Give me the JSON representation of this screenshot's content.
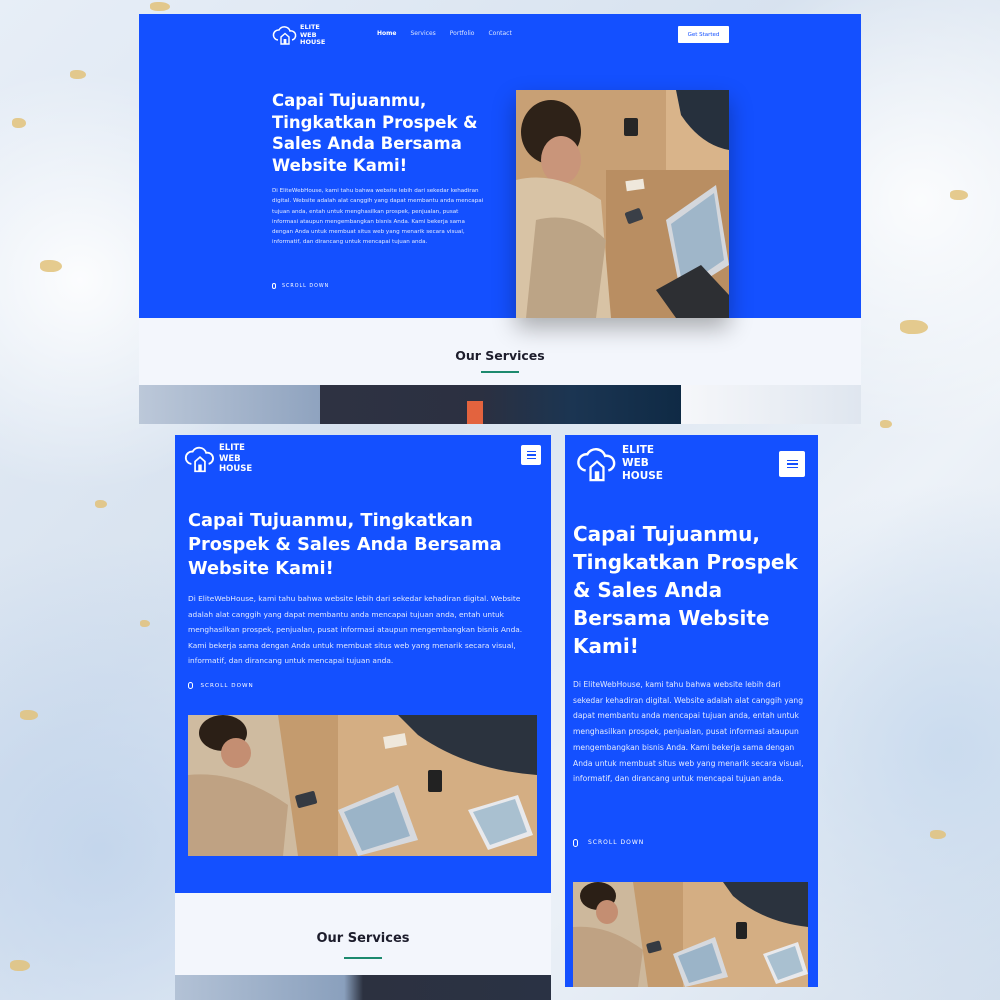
{
  "brand": {
    "line1": "ELITE",
    "line2": "WEB",
    "line3": "HOUSE"
  },
  "nav": {
    "home": "Home",
    "services": "Services",
    "portfolio": "Portfolio",
    "contact": "Contact"
  },
  "cta_label": "Get Started",
  "hero": {
    "headline": "Capai Tujuanmu, Tingkatkan Prospek & Sales Anda Bersama Website Kami!",
    "paragraph": "Di EliteWebHouse, kami tahu bahwa website lebih dari sekedar kehadiran digital. Website adalah alat canggih yang dapat membantu anda mencapai tujuan anda, entah untuk menghasilkan prospek, penjualan, pusat informasi ataupun mengembangkan bisnis Anda. Kami bekerja sama dengan Anda untuk membuat situs web yang menarik secara visual, informatif, dan dirancang untuk mencapai tujuan anda.",
    "scroll_label": "SCROLL DOWN"
  },
  "services": {
    "title": "Our Services"
  },
  "colors": {
    "primary": "#1450ff",
    "section_bg": "#f3f6fc",
    "accent_line": "#1d8a6e",
    "text_dark": "#1d1d2c"
  },
  "icons": {
    "logo": "cloud-house-icon",
    "menu": "hamburger-menu-icon",
    "scroll": "mouse-icon"
  }
}
